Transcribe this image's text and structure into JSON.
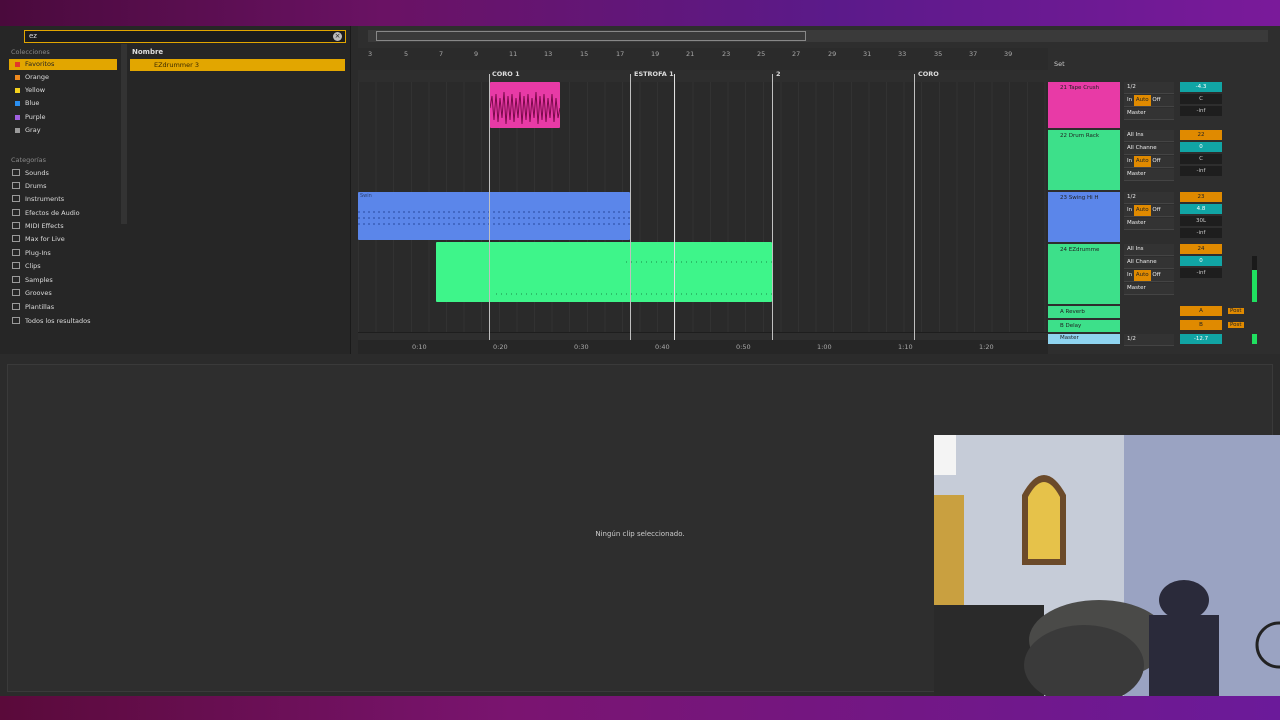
{
  "browser": {
    "search_value": "ez",
    "collections_title": "Colecciones",
    "collections": [
      {
        "label": "Favoritos",
        "color": "#e2382a",
        "selected": true
      },
      {
        "label": "Orange",
        "color": "#f08a1e",
        "selected": false
      },
      {
        "label": "Yellow",
        "color": "#f5d21e",
        "selected": false
      },
      {
        "label": "Blue",
        "color": "#2a8ef0",
        "selected": false
      },
      {
        "label": "Purple",
        "color": "#a060e0",
        "selected": false
      },
      {
        "label": "Gray",
        "color": "#9a9a9a",
        "selected": false
      }
    ],
    "categories_title": "Categorías",
    "categories": [
      "Sounds",
      "Drums",
      "Instruments",
      "Efectos de Audio",
      "MIDI Effects",
      "Max for Live",
      "Plug-Ins",
      "Clips",
      "Samples",
      "Grooves",
      "Plantillas",
      "Todos los resultados"
    ],
    "column_header": "Nombre",
    "results": [
      "EZdrummer 3"
    ]
  },
  "arrangement": {
    "bar_numbers": [
      "3",
      "5",
      "7",
      "9",
      "11",
      "13",
      "15",
      "17",
      "19",
      "21",
      "23",
      "25",
      "27",
      "29",
      "31",
      "33",
      "35",
      "37",
      "39"
    ],
    "locators": [
      "CORO 1",
      "ESTROFA 1",
      "2",
      "CORO"
    ],
    "set_label": "Set",
    "time_labels": [
      "0:10",
      "0:20",
      "0:30",
      "0:40",
      "0:50",
      "1:00",
      "1:10",
      "1:20"
    ],
    "clip_swing_label": "Swin",
    "colors": {
      "pink": "#e83aa6",
      "blue": "#5b86ea",
      "green": "#3ef58a",
      "accent": "#e2a600"
    }
  },
  "mixer": {
    "tracks": [
      {
        "name": "21 Tape Crush",
        "color": "#e83aa6"
      },
      {
        "name": "22 Drum Rack",
        "color": "#3de08a"
      },
      {
        "name": "23 Swing Hi H",
        "color": "#5b86ea"
      },
      {
        "name": "24 EZdrumme",
        "color": "#3de08a"
      },
      {
        "name": "A Reverb",
        "color": "#3de08a"
      },
      {
        "name": "B Delay",
        "color": "#3de08a"
      },
      {
        "name": "Master",
        "color": "#8fd4f0"
      }
    ],
    "io_labels": {
      "half": "1/2",
      "all_ins": "All Ins",
      "all_channels": "All Channe",
      "in": "In",
      "auto": "Auto",
      "off": "Off",
      "master": "Master"
    },
    "volumes": [
      "-4.3",
      "0",
      "4.8",
      "0",
      "0",
      "-12.7"
    ],
    "track_numbers": [
      "22",
      "23",
      "24"
    ],
    "pans": [
      "C",
      "C",
      "30L"
    ],
    "inf": "-inf",
    "sends": [
      "A",
      "B"
    ],
    "post": "Post"
  },
  "detail": {
    "message": "Ningún clip seleccionado."
  }
}
